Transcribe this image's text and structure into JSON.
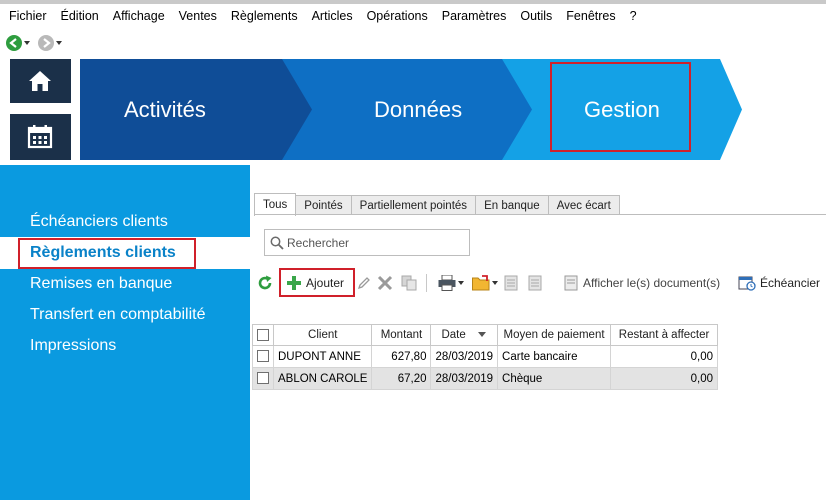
{
  "menu": [
    "Fichier",
    "Édition",
    "Affichage",
    "Ventes",
    "Règlements",
    "Articles",
    "Opérations",
    "Paramètres",
    "Outils",
    "Fenêtres",
    "?"
  ],
  "nav": {
    "back_icon": "back-arrow-icon",
    "forward_icon": "forward-arrow-icon"
  },
  "tiles": {
    "home_icon": "home-icon",
    "calendar_icon": "calendar-icon"
  },
  "banner": {
    "activites": "Activités",
    "donnees": "Données",
    "gestion": "Gestion",
    "colors": {
      "activites": "#0f4d97",
      "donnees": "#0e6fc4",
      "gestion": "#14a1e6"
    }
  },
  "leftpanel": {
    "items": [
      "Échéanciers clients",
      "Règlements clients",
      "Remises en banque",
      "Transfert en comptabilité",
      "Impressions"
    ],
    "active_index": 1,
    "color": "#0a9ae0"
  },
  "tabs": [
    "Tous",
    "Pointés",
    "Partiellement pointés",
    "En banque",
    "Avec écart"
  ],
  "active_tab": 0,
  "search": {
    "placeholder": "Rechercher"
  },
  "toolbar": {
    "ajouter": "Ajouter",
    "afficher": "Afficher le(s) document(s)",
    "echeancier": "Échéancier"
  },
  "table": {
    "headers": [
      "",
      "Client",
      "Montant",
      "Date",
      "Moyen de paiement",
      "Restant à affecter"
    ],
    "rows": [
      {
        "client": "DUPONT ANNE",
        "montant": "627,80",
        "date": "28/03/2019",
        "moyen": "Carte bancaire",
        "restant": "0,00"
      },
      {
        "client": "ABLON CAROLE",
        "montant": "67,20",
        "date": "28/03/2019",
        "moyen": "Chèque",
        "restant": "0,00"
      }
    ],
    "selected_row": 1
  }
}
